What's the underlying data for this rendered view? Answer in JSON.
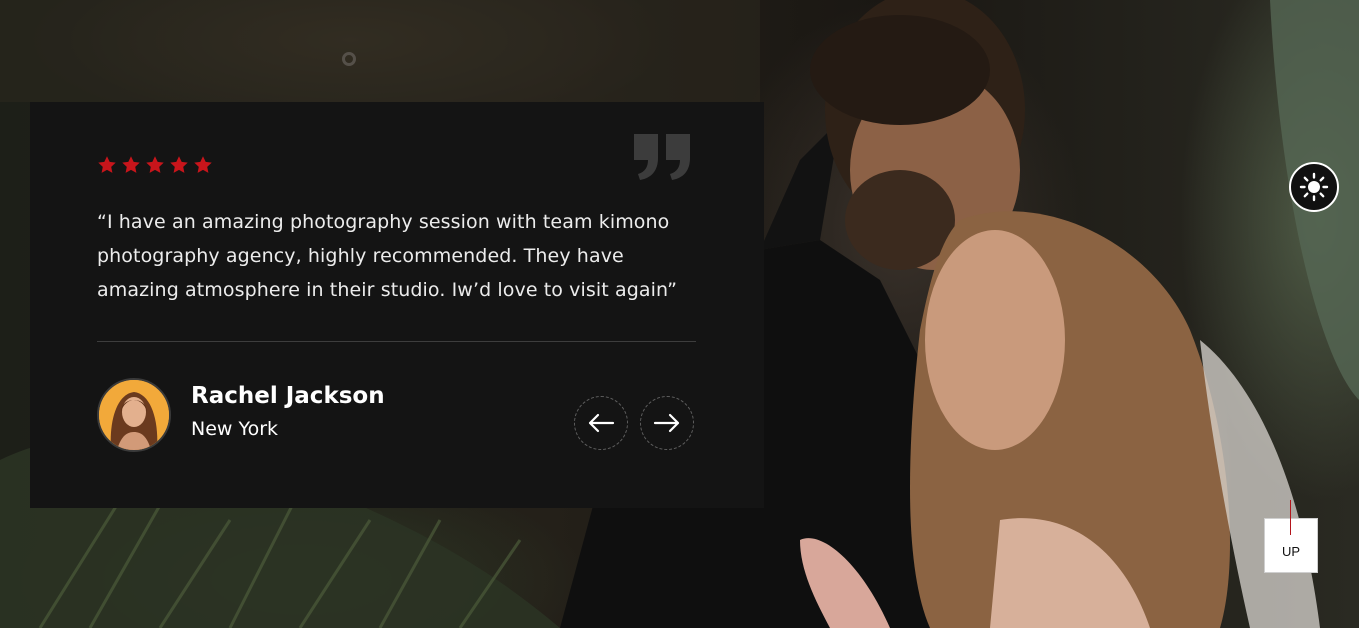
{
  "testimonial": {
    "rating": 5,
    "quote": "“I have an amazing photography session with team kimono photography agency, highly recommended. They have amazing atmosphere in their studio. Iw’d love to visit again”",
    "author": {
      "name": "Rachel Jackson",
      "location": "New York"
    }
  },
  "controls": {
    "up_label": "UP"
  },
  "icons": {
    "rating": "star-icon",
    "quote": "quote-icon",
    "prev": "arrow-left-icon",
    "next": "arrow-right-icon",
    "theme": "sun-icon"
  },
  "colors": {
    "accent": "#c8151b",
    "card_background": "#141414",
    "text": "#ececec"
  }
}
